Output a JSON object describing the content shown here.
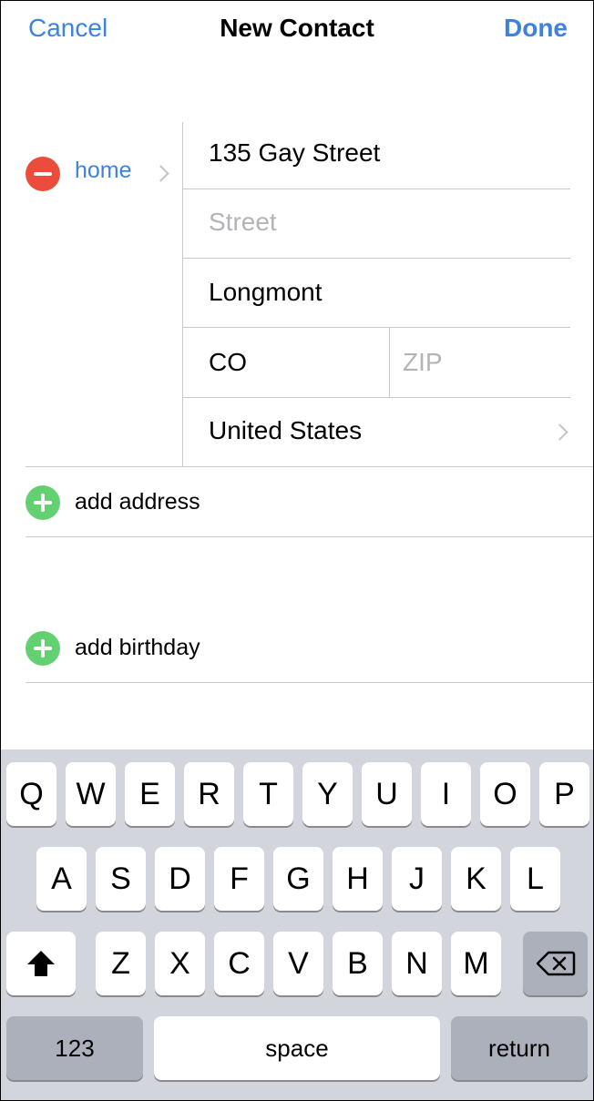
{
  "nav": {
    "cancel": "Cancel",
    "title": "New Contact",
    "done": "Done"
  },
  "address": {
    "type_label": "home",
    "street1": "135 Gay Street",
    "street2_placeholder": "Street",
    "city": "Longmont",
    "state": "CO",
    "zip_placeholder": "ZIP",
    "country": "United States"
  },
  "rows": {
    "add_address": "add address",
    "add_birthday": "add birthday"
  },
  "keyboard": {
    "row1": [
      "Q",
      "W",
      "E",
      "R",
      "T",
      "Y",
      "U",
      "I",
      "O",
      "P"
    ],
    "row2": [
      "A",
      "S",
      "D",
      "F",
      "G",
      "H",
      "J",
      "K",
      "L"
    ],
    "row3": [
      "Z",
      "X",
      "C",
      "V",
      "B",
      "N",
      "M"
    ],
    "numbers": "123",
    "space": "space",
    "return": "return"
  },
  "colors": {
    "accent": "#3e82e0",
    "remove": "#eb4d3d",
    "add": "#63d172",
    "keyboard_bg": "#d2d5db",
    "dark_key": "#abb0bb"
  }
}
